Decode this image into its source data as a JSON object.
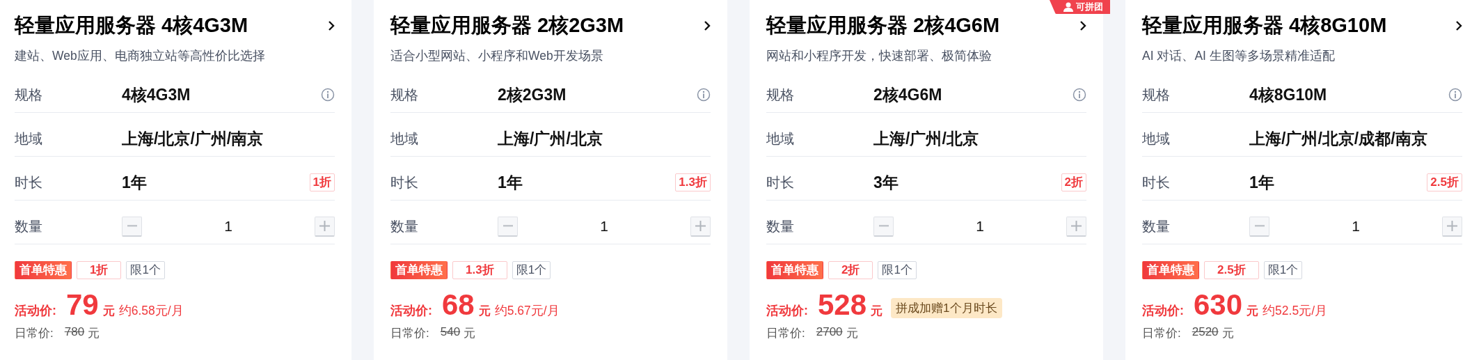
{
  "cards": [
    {
      "title": "轻量应用服务器 4核4G3M",
      "subtitle": "建站、Web应用、电商独立站等高性价比选择",
      "rows": [
        {
          "kind": "spec",
          "label": "规格",
          "value": "4核4G3M"
        },
        {
          "kind": "region",
          "label": "地域",
          "value": "上海/北京/广州/南京"
        },
        {
          "kind": "duration",
          "label": "时长",
          "value": "1年",
          "discount": "1折"
        },
        {
          "kind": "quantity",
          "label": "数量",
          "value": "1"
        }
      ],
      "tags": [
        {
          "kind": "promo",
          "text": "首单特惠"
        },
        {
          "kind": "discount",
          "text": "1折"
        },
        {
          "kind": "limit",
          "text": "限1个"
        }
      ],
      "price": {
        "label": "活动价:",
        "amount": "79",
        "unit": "元",
        "note": {
          "kind": "monthly",
          "text": "约6.58元/月"
        }
      },
      "regular": {
        "label": "日常价:",
        "amount": "780",
        "unit": "元"
      }
    },
    {
      "title": "轻量应用服务器 2核2G3M",
      "subtitle": "适合小型网站、小程序和Web开发场景",
      "rows": [
        {
          "kind": "spec",
          "label": "规格",
          "value": "2核2G3M"
        },
        {
          "kind": "region",
          "label": "地域",
          "value": "上海/广州/北京"
        },
        {
          "kind": "duration",
          "label": "时长",
          "value": "1年",
          "discount": "1.3折"
        },
        {
          "kind": "quantity",
          "label": "数量",
          "value": "1"
        }
      ],
      "tags": [
        {
          "kind": "promo",
          "text": "首单特惠"
        },
        {
          "kind": "discount",
          "text": "1.3折"
        },
        {
          "kind": "limit",
          "text": "限1个"
        }
      ],
      "price": {
        "label": "活动价:",
        "amount": "68",
        "unit": "元",
        "note": {
          "kind": "monthly",
          "text": "约5.67元/月"
        }
      },
      "regular": {
        "label": "日常价:",
        "amount": "540",
        "unit": "元"
      }
    },
    {
      "badge": "可拼团",
      "title": "轻量应用服务器 2核4G6M",
      "subtitle": "网站和小程序开发，快速部署、极简体验",
      "rows": [
        {
          "kind": "spec",
          "label": "规格",
          "value": "2核4G6M"
        },
        {
          "kind": "region",
          "label": "地域",
          "value": "上海/广州/北京"
        },
        {
          "kind": "duration",
          "label": "时长",
          "value": "3年",
          "discount": "2折"
        },
        {
          "kind": "quantity",
          "label": "数量",
          "value": "1"
        }
      ],
      "tags": [
        {
          "kind": "promo",
          "text": "首单特惠"
        },
        {
          "kind": "discount",
          "text": "2折"
        },
        {
          "kind": "limit",
          "text": "限1个"
        }
      ],
      "price": {
        "label": "活动价:",
        "amount": "528",
        "unit": "元",
        "note": {
          "kind": "bonus",
          "text": "拼成加赠1个月时长"
        }
      },
      "regular": {
        "label": "日常价:",
        "amount": "2700",
        "unit": "元"
      }
    },
    {
      "title": "轻量应用服务器 4核8G10M",
      "subtitle": "AI 对话、AI 生图等多场景精准适配",
      "rows": [
        {
          "kind": "spec",
          "label": "规格",
          "value": "4核8G10M"
        },
        {
          "kind": "region",
          "label": "地域",
          "value": "上海/广州/北京/成都/南京"
        },
        {
          "kind": "duration",
          "label": "时长",
          "value": "1年",
          "discount": "2.5折"
        },
        {
          "kind": "quantity",
          "label": "数量",
          "value": "1"
        }
      ],
      "tags": [
        {
          "kind": "promo",
          "text": "首单特惠"
        },
        {
          "kind": "discount",
          "text": "2.5折"
        },
        {
          "kind": "limit",
          "text": "限1个"
        }
      ],
      "price": {
        "label": "活动价:",
        "amount": "630",
        "unit": "元",
        "note": {
          "kind": "monthly",
          "text": "约52.5元/月"
        }
      },
      "regular": {
        "label": "日常价:",
        "amount": "2520",
        "unit": "元"
      }
    }
  ]
}
